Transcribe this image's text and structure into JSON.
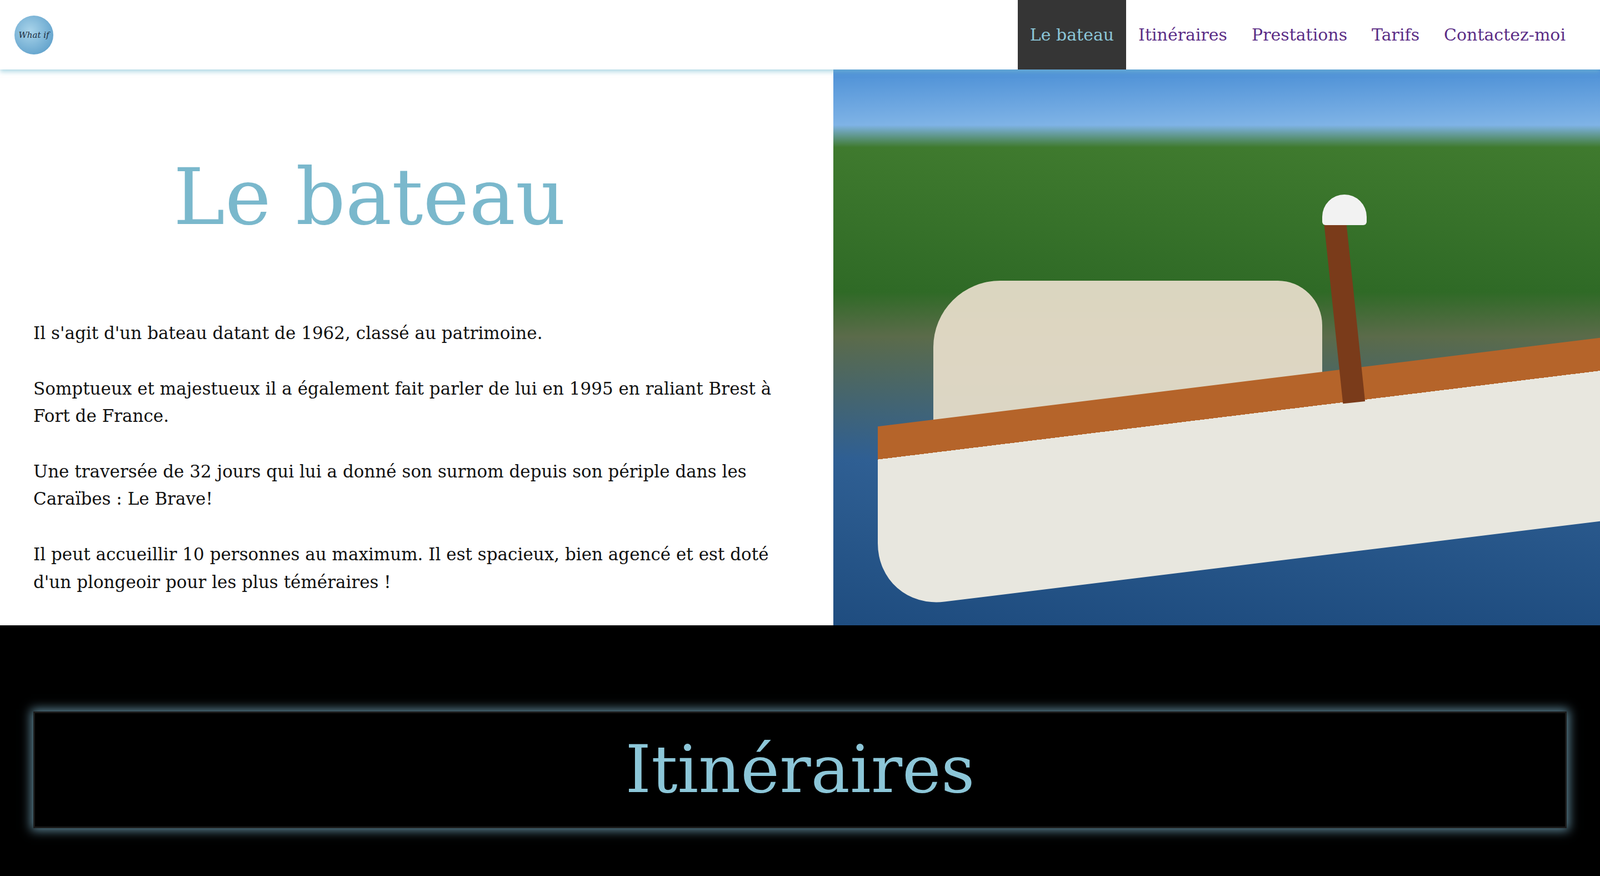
{
  "logo": {
    "text": "What if"
  },
  "nav": [
    {
      "label": "Le bateau",
      "selected": true
    },
    {
      "label": "Itinéraires",
      "selected": false
    },
    {
      "label": "Prestations",
      "selected": false
    },
    {
      "label": "Tarifs",
      "selected": false
    },
    {
      "label": "Contactez-moi",
      "selected": false
    }
  ],
  "hero": {
    "title": "Le bateau",
    "paragraphs": [
      "Il s'agit d'un bateau datant de 1962, classé au patrimoine.",
      "Somptueux et majestueux il a également fait parler de lui en 1995 en raliant Brest à Fort de France.",
      "Une traversée de 32 jours qui lui a donné son surnom depuis son périple dans les Caraïbes : Le Brave!",
      "Il peut accueillir 10 personnes au maximum. Il est spacieux, bien agencé et est doté d'un plongeoir pour les plus téméraires !"
    ]
  },
  "section": {
    "title": "Itinéraires"
  }
}
